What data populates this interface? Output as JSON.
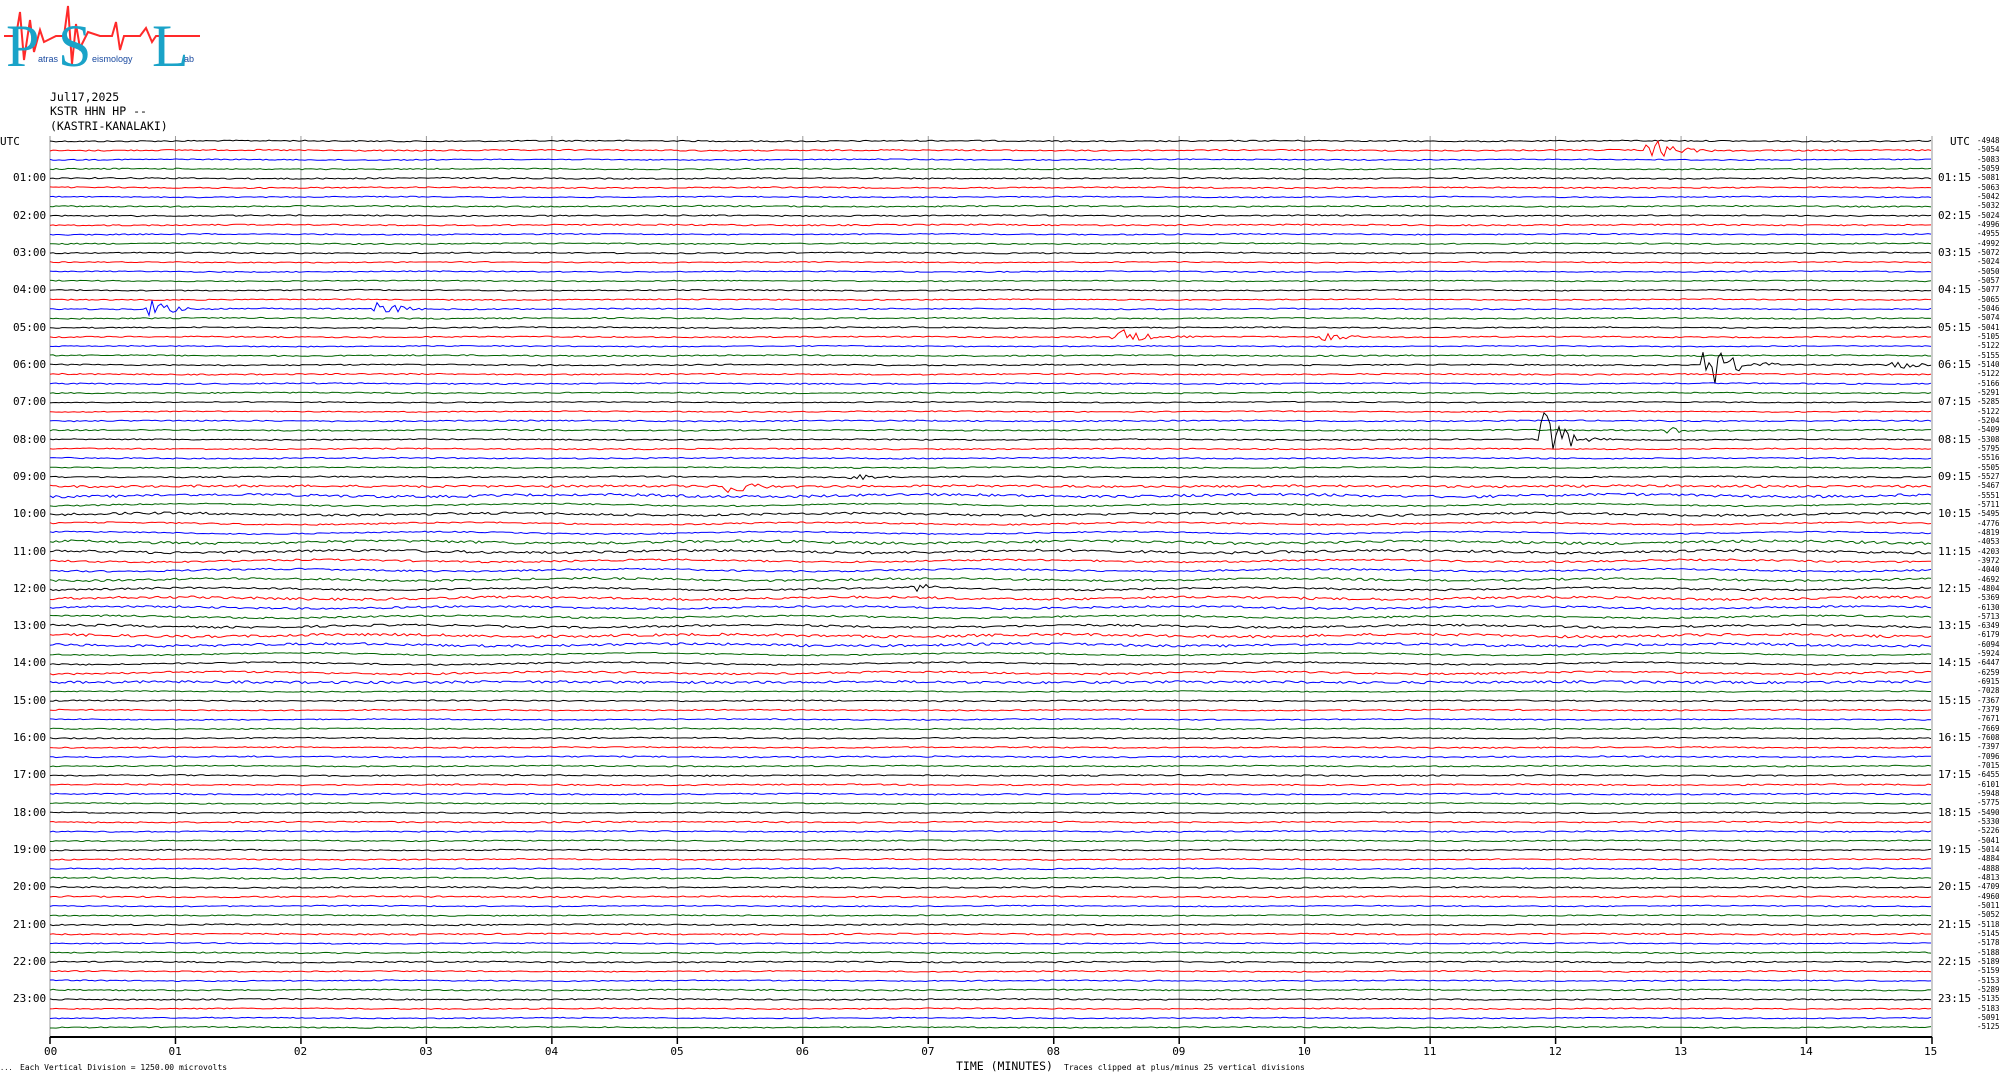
{
  "header": {
    "date": "Jul17,2025",
    "station": "KSTR HHN HP --",
    "location": "(KASTRI-KANALAKI)"
  },
  "logo": {
    "letters": [
      "P",
      "S",
      "L"
    ],
    "fragments": [
      "atras",
      "eismology",
      "ab"
    ],
    "colors": {
      "letters": "#1aa3c8",
      "wave": "#ff2a2a"
    }
  },
  "footer": {
    "scale_note": "Each Vertical Division = 1250.00 microvolts",
    "xlabel": "TIME (MINUTES)",
    "clip_note": "Traces clipped at plus/minus 25 vertical divisions",
    "corner_mark": "..."
  },
  "chart_data": {
    "type": "line",
    "title": "",
    "xlabel": "TIME (MINUTES)",
    "xlim": [
      0,
      15
    ],
    "x_ticks": [
      "00",
      "01",
      "02",
      "03",
      "04",
      "05",
      "06",
      "07",
      "08",
      "09",
      "10",
      "11",
      "12",
      "13",
      "14",
      "15"
    ],
    "left_axis_label": "UTC",
    "right_axis_label": "UTC",
    "left_hour_labels": [
      "01:00",
      "02:00",
      "03:00",
      "04:00",
      "05:00",
      "06:00",
      "07:00",
      "08:00",
      "09:00",
      "10:00",
      "11:00",
      "12:00",
      "13:00",
      "14:00",
      "15:00",
      "16:00",
      "17:00",
      "18:00",
      "19:00",
      "20:00",
      "21:00",
      "22:00",
      "23:00"
    ],
    "right_hour_labels": [
      "01:15",
      "02:15",
      "03:15",
      "04:15",
      "05:15",
      "06:15",
      "07:15",
      "08:15",
      "09:15",
      "10:15",
      "11:15",
      "12:15",
      "13:15",
      "14:15",
      "15:15",
      "16:15",
      "17:15",
      "18:15",
      "19:15",
      "20:15",
      "21:15",
      "22:15",
      "23:15"
    ],
    "trace_colors": [
      "#000000",
      "#ff0000",
      "#0000ff",
      "#006400"
    ],
    "traces_per_hour": 4,
    "trace_count": 96,
    "right_values": [
      "-4948",
      "-5054",
      "-5083",
      "-5059",
      "-5081",
      "-5063",
      "-5042",
      "-5032",
      "-5024",
      "-4996",
      "-4955",
      "-4992",
      "-5072",
      "-5024",
      "-5050",
      "-5057",
      "-5077",
      "-5065",
      "-5046",
      "-5074",
      "-5041",
      "-5105",
      "-5122",
      "-5155",
      "-5140",
      "-5122",
      "-5166",
      "-5291",
      "-5285",
      "-5122",
      "-5204",
      "-5409",
      "-5308",
      "-5795",
      "-5516",
      "-5505",
      "-5527",
      "-5467",
      "-5551",
      "-5711",
      "-5495",
      "-4776",
      "-4819",
      "-4053",
      "-4203",
      "-3972",
      "-4040",
      "-4692",
      "-4804",
      "-5369",
      "-6130",
      "-5713",
      "-6349",
      "-6179",
      "-6094",
      "-5924",
      "-6447",
      "-6259",
      "-6915",
      "-7028",
      "-7367",
      "-7379",
      "-7671",
      "-7669",
      "-7608",
      "-7397",
      "-7096",
      "-7015",
      "-6455",
      "-6101",
      "-5948",
      "-5775",
      "-5490",
      "-5330",
      "-5226",
      "-5041",
      "-5014",
      "-4884",
      "-4888",
      "-4813",
      "-4709",
      "-4960",
      "-5011",
      "-5052",
      "-5118",
      "-5145",
      "-5178",
      "-5188",
      "-5189",
      "-5159",
      "-5153",
      "-5289",
      "-5135",
      "-5183",
      "-5091",
      "-5125"
    ],
    "events": [
      {
        "trace": 1,
        "minute": 12.75,
        "amplitude": 14
      },
      {
        "trace": 18,
        "minute": 0.8,
        "amplitude": 10
      },
      {
        "trace": 18,
        "minute": 2.6,
        "amplitude": 10
      },
      {
        "trace": 21,
        "minute": 8.5,
        "amplitude": 13
      },
      {
        "trace": 21,
        "minute": 10.15,
        "amplitude": 5
      },
      {
        "trace": 24,
        "minute": 13.2,
        "amplitude": 30
      },
      {
        "trace": 24,
        "minute": 14.7,
        "amplitude": 5
      },
      {
        "trace": 32,
        "minute": 11.9,
        "amplitude": 28
      },
      {
        "trace": 31,
        "minute": 12.9,
        "amplitude": 4
      },
      {
        "trace": 37,
        "minute": 5.4,
        "amplitude": 10
      },
      {
        "trace": 36,
        "minute": 6.4,
        "amplitude": 4
      },
      {
        "trace": 48,
        "minute": 6.9,
        "amplitude": 5
      }
    ]
  }
}
